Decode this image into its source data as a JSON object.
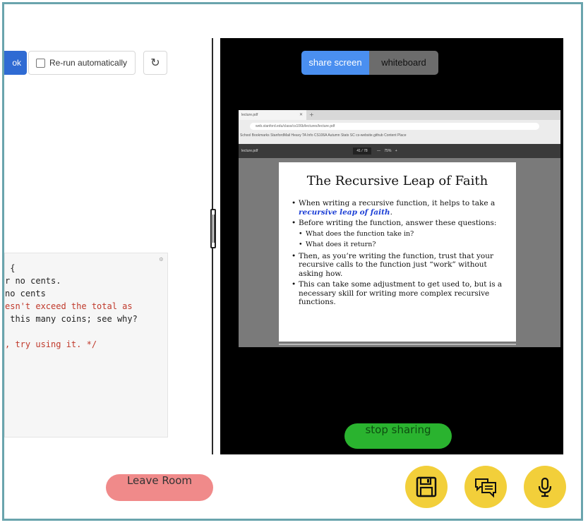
{
  "editor": {
    "run_label": "ok",
    "rerun_label": "Re-run automatically",
    "refresh_icon": "refresh-icon",
    "code_lines": [
      {
        "text": " {",
        "color": "#222222"
      },
      {
        "text": "r no cents.",
        "color": "#222222"
      },
      {
        "text": "no cents",
        "color": "#222222"
      },
      {
        "text": "esn't exceed the total as",
        "color": "#c0392b"
      },
      {
        "text": " this many coins; see why?",
        "color": "#222222"
      },
      {
        "text": "",
        "color": "#222222"
      },
      {
        "text": ", try using it. */",
        "color": "#c0392b"
      }
    ]
  },
  "share": {
    "tab_share": "share screen",
    "tab_whiteboard": "whiteboard",
    "active_tab": "share screen",
    "stop_label": "stop sharing"
  },
  "browser": {
    "tab_title": "lecture.pdf",
    "address": "web.stanford.edu/class/cs106b/lectures/lecture.pdf",
    "bookmarks": "School   Bookmarks   StanfordMail   Heavy TA Info   CS106A   Autumn Stats   SC   cs-website.github   Content Place"
  },
  "pdf": {
    "filename": "lecture.pdf",
    "page": "41 / 78",
    "zoom": "—  75%  +"
  },
  "slide": {
    "title": "The Recursive Leap of Faith",
    "b1_a": "When writing a recursive function, it helps to take a ",
    "b1_em": "recursive leap of faith",
    "b1_b": ".",
    "b2": "Before writing the function, answer these questions:",
    "b2_sub1": "What does the function take in?",
    "b2_sub2": "What does it return?",
    "b3": "Then, as you’re writing the function, trust that your recursive calls to the function just “work” without asking how.",
    "b4": "This can take some adjustment to get used to, but is a necessary skill for writing more complex recursive functions."
  },
  "footer": {
    "leave_label": "Leave Room",
    "buttons": [
      "save-icon",
      "chat-icon",
      "microphone-icon"
    ]
  },
  "colors": {
    "frame": "#6aa4ad",
    "share_active": "#4a8ff0",
    "stop": "#2ab32f",
    "leave": "#f08a8a",
    "icon_button": "#f2cf3a"
  }
}
